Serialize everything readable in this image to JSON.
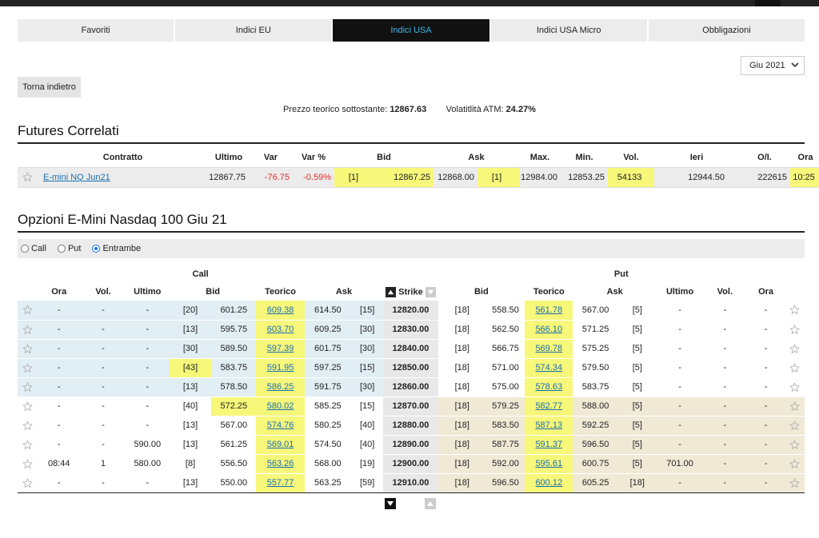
{
  "tabs": [
    {
      "label": "Favoriti"
    },
    {
      "label": "Indici EU"
    },
    {
      "label": "Indici USA",
      "active": true
    },
    {
      "label": "Indici USA Micro"
    },
    {
      "label": "Obbligazioni"
    }
  ],
  "month_select": "Giu 2021",
  "back_label": "Torna indietro",
  "summary": {
    "price_label": "Prezzo teorico sottostante:",
    "price_value": "12867.63",
    "vol_label": "Volatitlità ATM:",
    "vol_value": "24.27%"
  },
  "futures": {
    "title": "Futures Correlati",
    "headers": [
      "Contratto",
      "Ultimo",
      "Var",
      "Var %",
      "Bid",
      "Ask",
      "Max.",
      "Min.",
      "Vol.",
      "Ieri",
      "O/I.",
      "Ora"
    ],
    "row": {
      "contract": "E-mini NQ Jun21",
      "last": "12867.75",
      "var": "-76.75",
      "varp": "-0.59%",
      "bid_qty": "[1]",
      "bid": "12867.25",
      "ask": "12868.00",
      "ask_qty": "[1]",
      "max": "12984.00",
      "min": "12853.25",
      "vol": "54133",
      "prev": "12944.50",
      "oi": "222615",
      "time": "10:25"
    }
  },
  "options": {
    "title": "Opzioni E-Mini Nasdaq 100 Giu 21",
    "radio": [
      {
        "label": "Call"
      },
      {
        "label": "Put"
      },
      {
        "label": "Entrambe",
        "checked": true
      }
    ],
    "group_call": "Call",
    "group_put": "Put",
    "headers": {
      "ora": "Ora",
      "vol": "Vol.",
      "ultimo": "Ultimo",
      "bid": "Bid",
      "teorico": "Teorico",
      "ask": "Ask",
      "strike": "Strike"
    },
    "rows": [
      {
        "c": [
          "-",
          "-",
          "-",
          "[20]",
          "601.25",
          "609.38",
          "614.50",
          "[15]"
        ],
        "k": "12820.00",
        "p": [
          "[18]",
          "558.50",
          "561.78",
          "567.00",
          "[5]",
          "-",
          "-",
          "-"
        ],
        "itm": "call"
      },
      {
        "c": [
          "-",
          "-",
          "-",
          "[13]",
          "595.75",
          "603.70",
          "609.25",
          "[30]"
        ],
        "k": "12830.00",
        "p": [
          "[18]",
          "562.50",
          "566.10",
          "571.25",
          "[5]",
          "-",
          "-",
          "-"
        ],
        "itm": "call"
      },
      {
        "c": [
          "-",
          "-",
          "-",
          "[30]",
          "589.50",
          "597.39",
          "601.75",
          "[30]"
        ],
        "k": "12840.00",
        "p": [
          "[18]",
          "566.75",
          "569.78",
          "575.25",
          "[5]",
          "-",
          "-",
          "-"
        ],
        "itm": "call"
      },
      {
        "c": [
          "-",
          "-",
          "-",
          "[43]",
          "583.75",
          "591.95",
          "597.25",
          "[15]"
        ],
        "k": "12850.00",
        "p": [
          "[18]",
          "571.00",
          "574.34",
          "579.50",
          "[5]",
          "-",
          "-",
          "-"
        ],
        "itm": "call",
        "hlBidQty": true
      },
      {
        "c": [
          "-",
          "-",
          "-",
          "[13]",
          "578.50",
          "586.25",
          "591.75",
          "[30]"
        ],
        "k": "12860.00",
        "p": [
          "[18]",
          "575.00",
          "578.63",
          "583.75",
          "[5]",
          "-",
          "-",
          "-"
        ],
        "itm": "call"
      },
      {
        "c": [
          "-",
          "-",
          "-",
          "[40]",
          "572.25",
          "580.02",
          "585.25",
          "[15]"
        ],
        "k": "12870.00",
        "p": [
          "[18]",
          "579.25",
          "582.77",
          "588.00",
          "[5]",
          "-",
          "-",
          "-"
        ],
        "itm": "put",
        "hlBid": true
      },
      {
        "c": [
          "-",
          "-",
          "-",
          "[13]",
          "567.00",
          "574.76",
          "580.25",
          "[40]"
        ],
        "k": "12880.00",
        "p": [
          "[18]",
          "583.50",
          "587.13",
          "592.25",
          "[5]",
          "-",
          "-",
          "-"
        ],
        "itm": "put"
      },
      {
        "c": [
          "-",
          "-",
          "590.00",
          "[13]",
          "561.25",
          "569.01",
          "574.50",
          "[40]"
        ],
        "k": "12890.00",
        "p": [
          "[18]",
          "587.75",
          "591.37",
          "596.50",
          "[5]",
          "-",
          "-",
          "-"
        ],
        "itm": "put"
      },
      {
        "c": [
          "08:44",
          "1",
          "580.00",
          "[8]",
          "556.50",
          "563.26",
          "568.00",
          "[19]"
        ],
        "k": "12900.00",
        "p": [
          "[18]",
          "592.00",
          "595.61",
          "600.75",
          "[5]",
          "701.00",
          "-",
          "-"
        ],
        "itm": "put"
      },
      {
        "c": [
          "-",
          "-",
          "-",
          "[13]",
          "550.00",
          "557.77",
          "563.25",
          "[59]"
        ],
        "k": "12910.00",
        "p": [
          "[18]",
          "596.50",
          "600.12",
          "605.25",
          "[18]",
          "-",
          "-",
          "-"
        ],
        "itm": "put"
      }
    ]
  }
}
